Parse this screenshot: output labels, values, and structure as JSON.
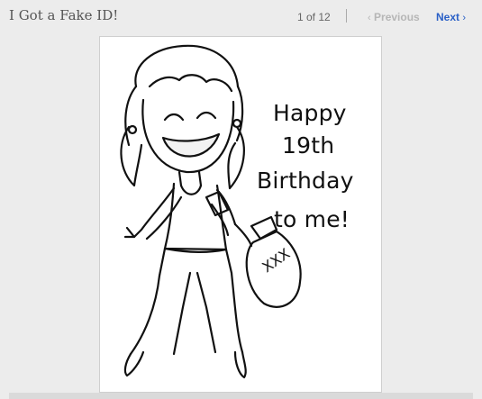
{
  "header": {
    "title": "I Got a Fake ID!",
    "counter": "1 of 12",
    "previous_label": "Previous",
    "next_label": "Next",
    "previous_icon": "chevron-left-icon",
    "next_icon": "chevron-right-icon"
  },
  "image": {
    "caption_lines": [
      "Happy",
      "19th",
      "Birthday",
      "to me!"
    ],
    "bottle_label": "XXX"
  },
  "colors": {
    "next_link": "#2a60c7",
    "previous_link_disabled": "#b6b6b6"
  }
}
